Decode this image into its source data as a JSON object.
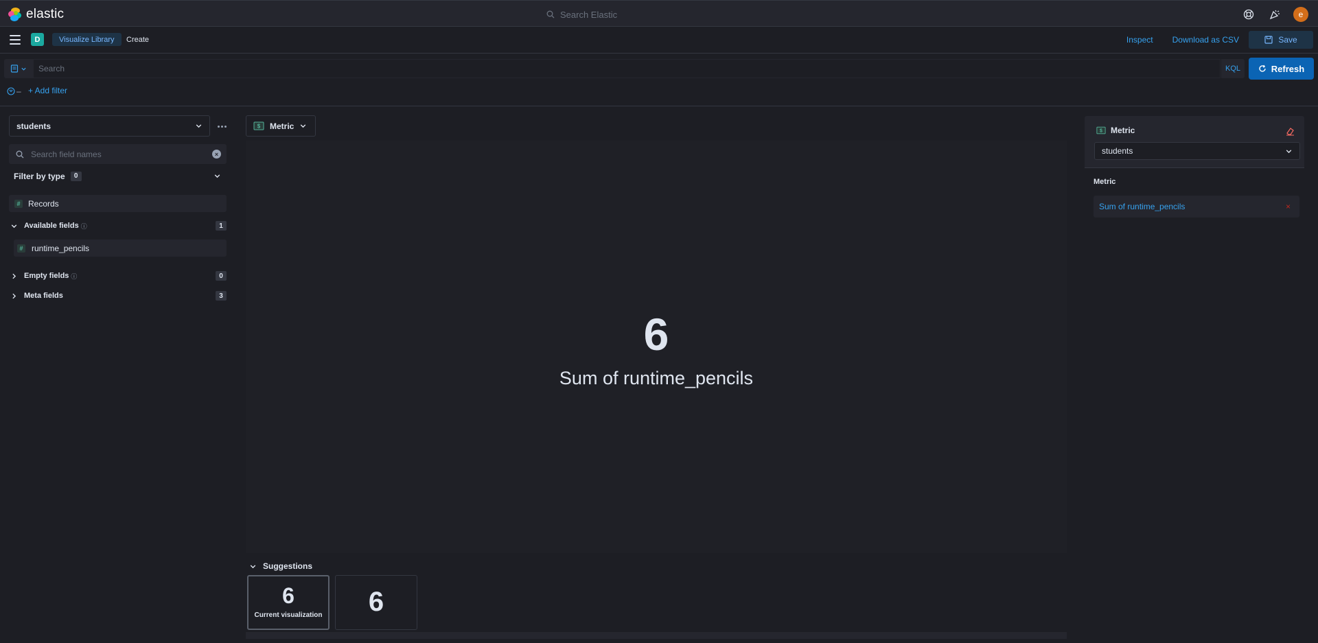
{
  "header": {
    "logo_text": "elastic",
    "search_placeholder": "Search Elastic",
    "avatar_letter": "e",
    "icons": [
      "help-icon",
      "news-icon",
      "avatar"
    ]
  },
  "nav": {
    "space_letter": "D",
    "breadcrumbs": [
      "Visualize Library",
      "Create"
    ],
    "inspect_label": "Inspect",
    "download_label": "Download as CSV",
    "save_label": "Save"
  },
  "query": {
    "placeholder": "Search",
    "language": "KQL",
    "refresh_label": "Refresh",
    "add_filter_label": "+ Add filter"
  },
  "left_panel": {
    "data_view": "students",
    "field_search_placeholder": "Search field names",
    "filter_by_type_label": "Filter by type",
    "filter_by_type_count": "0",
    "records_label": "Records",
    "available_fields_label": "Available fields",
    "available_fields_count": "1",
    "available_fields": [
      "runtime_pencils"
    ],
    "empty_fields_label": "Empty fields",
    "empty_fields_count": "0",
    "meta_fields_label": "Meta fields",
    "meta_fields_count": "3"
  },
  "workspace": {
    "vis_type": "Metric",
    "metric_value": "6",
    "metric_label": "Sum of runtime_pencils",
    "suggestions_label": "Suggestions",
    "suggestions": [
      {
        "value": "6",
        "caption": "Current visualization"
      },
      {
        "value": "6",
        "caption": ""
      }
    ]
  },
  "config_panel": {
    "title": "Metric",
    "data_view": "students",
    "section_label": "Metric",
    "dimension_label": "Sum of runtime_pencils"
  },
  "colors": {
    "accent": "#36a2ef",
    "primary_button": "#0b64b4",
    "space_badge": "#1ba9a0",
    "avatar": "#d36e1a",
    "danger": "#bd271e"
  }
}
